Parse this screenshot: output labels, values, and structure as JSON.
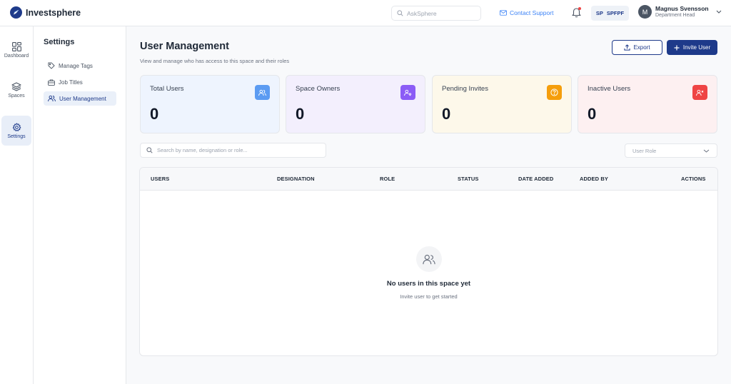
{
  "app": {
    "name": "Investsphere"
  },
  "topbar": {
    "search_placeholder": "AskSphere",
    "contact_label": "Contact Support",
    "space_chip": {
      "initials": "SP",
      "name": "SPFPF"
    },
    "user": {
      "initial": "M",
      "name": "Magnus Svensson",
      "role": "Department Head"
    }
  },
  "rail": [
    {
      "label": "Dashboard",
      "icon": "grid-icon"
    },
    {
      "label": "Spaces",
      "icon": "layers-icon"
    },
    {
      "label": "Settings",
      "icon": "gear-icon",
      "active": true
    }
  ],
  "sidebar": {
    "title": "Settings",
    "items": [
      {
        "label": "Manage Tags",
        "icon": "tag-icon"
      },
      {
        "label": "Job Titles",
        "icon": "briefcase-icon"
      },
      {
        "label": "User Management",
        "icon": "users-icon",
        "active": true
      }
    ]
  },
  "main": {
    "title": "User Management",
    "subtitle": "View and manage  who has access to this space and their roles",
    "export_label": "Export",
    "invite_label": "Invite User",
    "cards": [
      {
        "label": "Total Users",
        "value": "0",
        "color": "#5b9bf2",
        "bg": "#eef4fe"
      },
      {
        "label": "Space Owners",
        "value": "0",
        "color": "#8b5cf6",
        "bg": "#f3effd"
      },
      {
        "label": "Pending Invites",
        "value": "0",
        "color": "#f59e0b",
        "bg": "#fdf8ea"
      },
      {
        "label": "Inactive Users",
        "value": "0",
        "color": "#ef4444",
        "bg": "#fdf0f1"
      }
    ],
    "search_placeholder": "Search by name, designation or role...",
    "role_filter_placeholder": "User Role",
    "table": {
      "columns": [
        "USERS",
        "DESIGNATION",
        "ROLE",
        "STATUS",
        "DATE ADDED",
        "ADDED BY",
        "ACTIONS"
      ],
      "empty_title": "No users in this space yet",
      "empty_subtitle": "Invite user to get started"
    }
  }
}
